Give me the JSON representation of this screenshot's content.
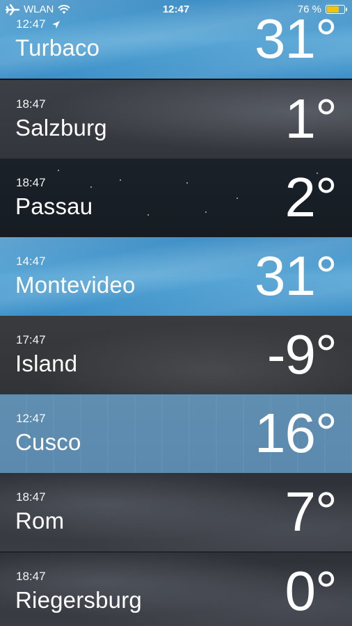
{
  "status_bar": {
    "carrier": "WLAN",
    "time": "12:47",
    "battery_percent": "76 %",
    "battery_level": 0.76,
    "battery_color": "#f5c400",
    "icons": [
      "airplane-icon",
      "wifi-icon",
      "battery-icon"
    ]
  },
  "cities": [
    {
      "time": "12:47",
      "name": "Turbaco",
      "temp": "31°",
      "current_location": true,
      "condition": "sunny"
    },
    {
      "time": "18:47",
      "name": "Salzburg",
      "temp": "1°",
      "condition": "cloudy"
    },
    {
      "time": "18:47",
      "name": "Passau",
      "temp": "2°",
      "condition": "night"
    },
    {
      "time": "14:47",
      "name": "Montevideo",
      "temp": "31°",
      "condition": "sunny"
    },
    {
      "time": "17:47",
      "name": "Island",
      "temp": "-9°",
      "condition": "overcast"
    },
    {
      "time": "12:47",
      "name": "Cusco",
      "temp": "16°",
      "condition": "rain"
    },
    {
      "time": "18:47",
      "name": "Rom",
      "temp": "7°",
      "condition": "storm"
    },
    {
      "time": "18:47",
      "name": "Riegersburg",
      "temp": "0°",
      "condition": "storm"
    }
  ]
}
